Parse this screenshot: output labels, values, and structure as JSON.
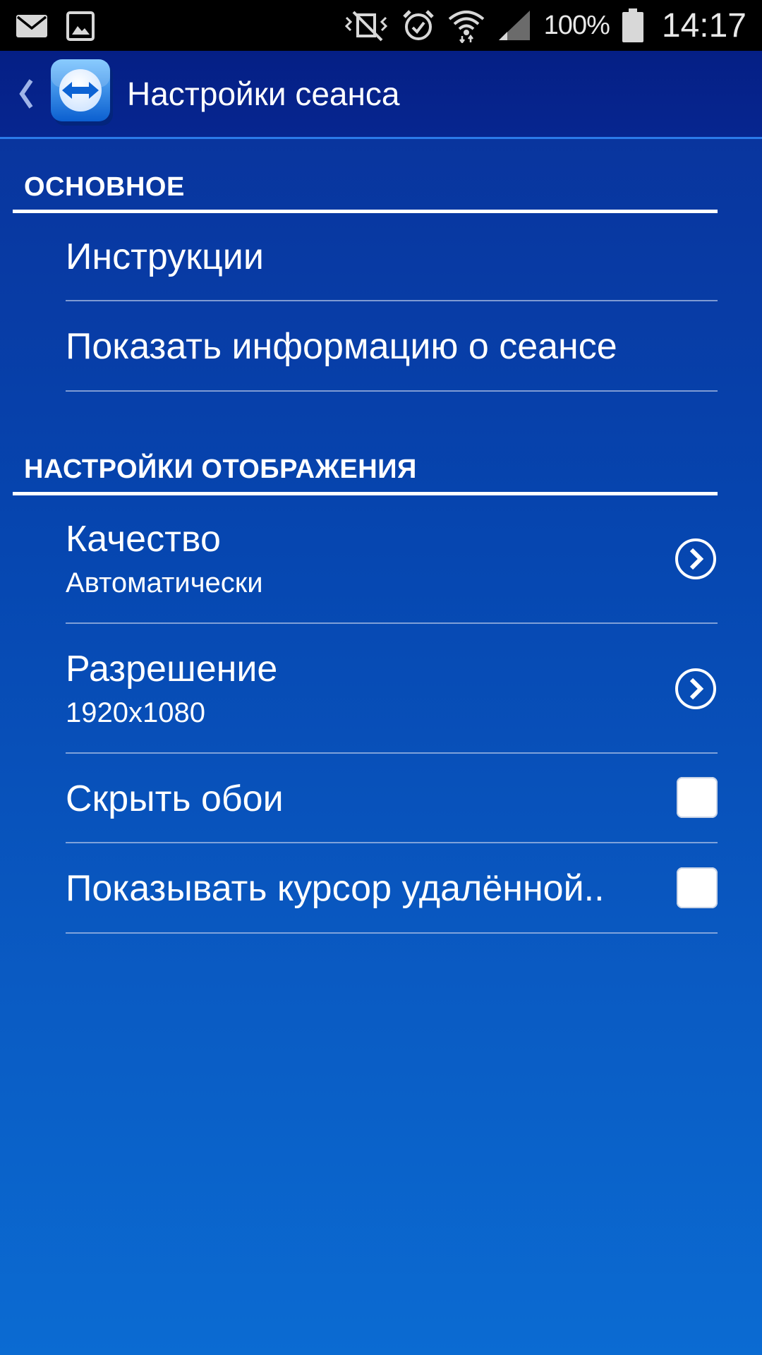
{
  "status_bar": {
    "battery_percent": "100%",
    "time": "14:17",
    "icons": [
      "mail-icon",
      "image-icon",
      "mute-vibrate-icon",
      "alarm-icon",
      "wifi-icon",
      "signal-icon",
      "battery-icon"
    ]
  },
  "action_bar": {
    "title": "Настройки сеанса",
    "app_icon": "teamviewer-logo-icon",
    "back_icon": "chevron-left-icon"
  },
  "sections": [
    {
      "header": "ОСНОВНОЕ",
      "items": [
        {
          "title": "Инструкции"
        },
        {
          "title": "Показать информацию о сеансе"
        }
      ]
    },
    {
      "header": "НАСТРОЙКИ ОТОБРАЖЕНИЯ",
      "items": [
        {
          "title": "Качество",
          "subtitle": "Автоматически",
          "control": "chevron-right-circle-icon"
        },
        {
          "title": "Разрешение",
          "subtitle": "1920x1080",
          "control": "chevron-right-circle-icon"
        },
        {
          "title": "Скрыть обои",
          "control": "checkbox",
          "checked": false
        },
        {
          "title": "Показывать курсор удалённой..",
          "control": "checkbox",
          "checked": false
        }
      ]
    }
  ],
  "colors": {
    "background_top": "#0a2f98",
    "background_bottom": "#0b6bd2",
    "action_bar": "#051f85",
    "accent_line": "#2b7bea"
  }
}
